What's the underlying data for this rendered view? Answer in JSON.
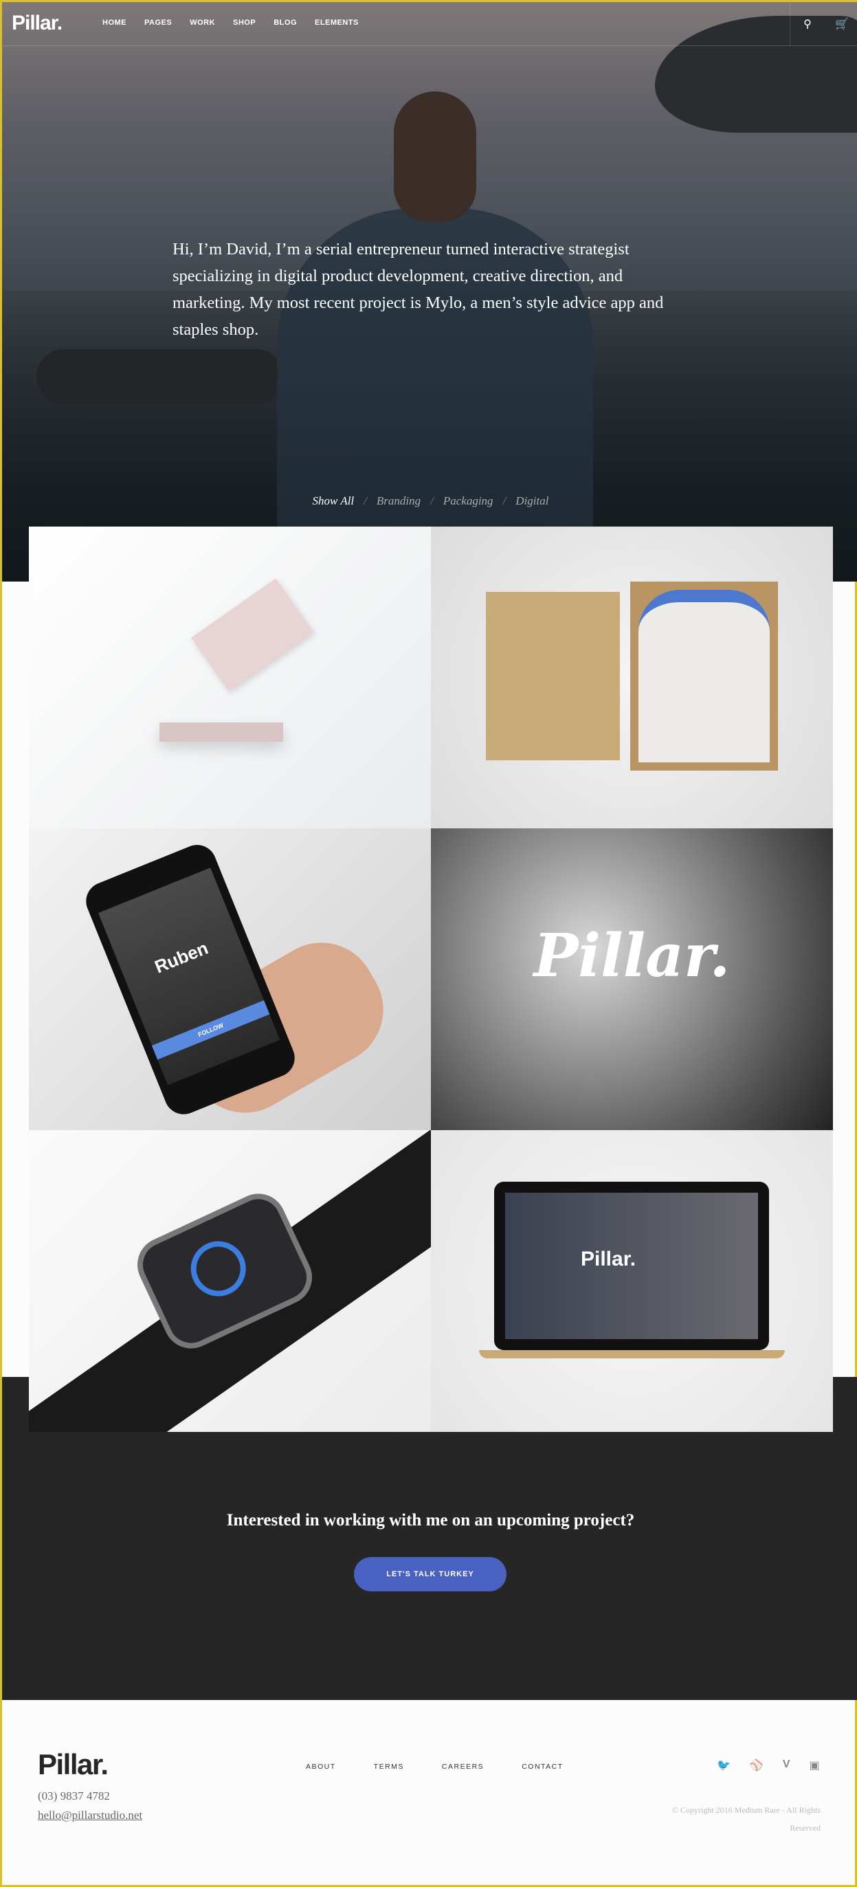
{
  "header": {
    "logo": "Pillar.",
    "nav": [
      "HOME",
      "PAGES",
      "WORK",
      "SHOP",
      "BLOG",
      "ELEMENTS"
    ],
    "icons": [
      "search-icon",
      "cart-icon"
    ]
  },
  "hero": {
    "intro": "Hi, I’m David, I’m a serial entrepreneur turned interactive strategist specializing in digital product development, creative direction, and marketing. My most recent project is Mylo, a men’s style advice app and staples shop."
  },
  "filters": {
    "items": [
      "Show All",
      "Branding",
      "Packaging",
      "Digital"
    ],
    "active": "Show All",
    "separator": "/"
  },
  "portfolio": {
    "items": [
      {
        "subject": "business cards"
      },
      {
        "subject": "apparel packaging"
      },
      {
        "subject": "mobile app",
        "screen_name": "Ruben",
        "button": "FOLLOW"
      },
      {
        "subject": "wave logo",
        "logo": "Pillar."
      },
      {
        "subject": "smartwatch app"
      },
      {
        "subject": "laptop website",
        "logo": "Pillar."
      }
    ]
  },
  "cta": {
    "text": "Interested in working with me on an upcoming project?",
    "button": "LET'S TALK TURKEY",
    "accent": "#4962c2"
  },
  "footer": {
    "logo": "Pillar.",
    "phone": "(03) 9837 4782",
    "email": "hello@pillarstudio.net",
    "nav": [
      "ABOUT",
      "TERMS",
      "CAREERS",
      "CONTACT"
    ],
    "social": [
      "twitter-icon",
      "dribbble-icon",
      "vimeo-icon",
      "instagram-icon"
    ],
    "copyright": "© Copyright 2016 Medium Rare - All Rights Reserved"
  }
}
